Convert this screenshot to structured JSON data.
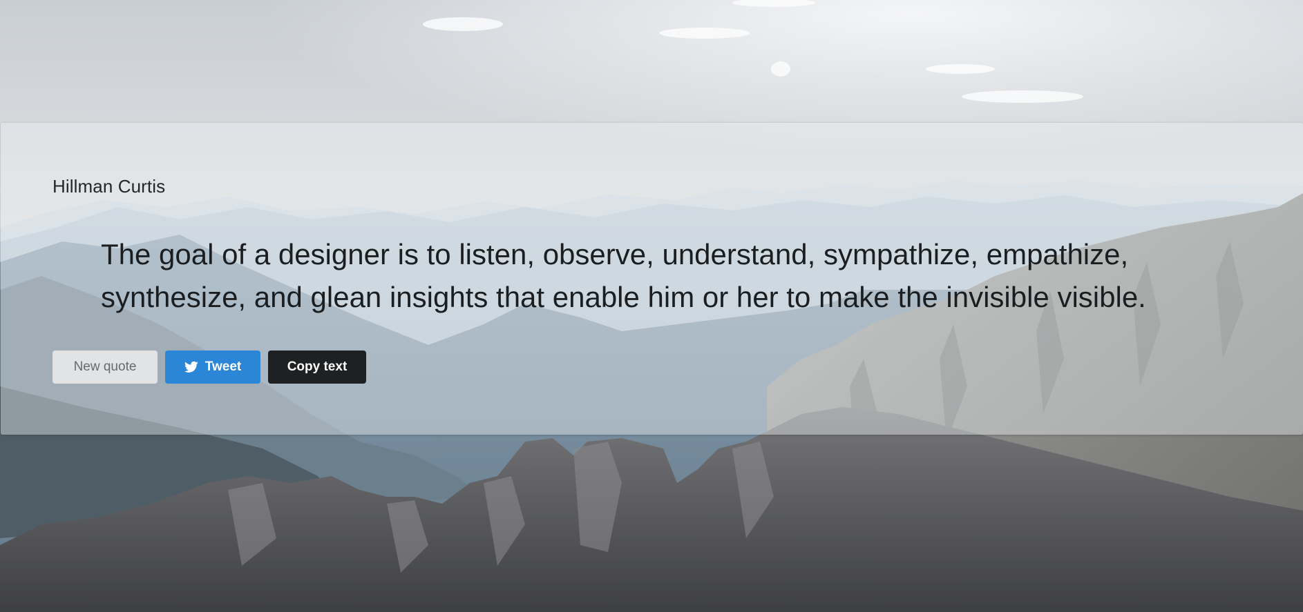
{
  "quote": {
    "author": "Hillman Curtis",
    "text": "The goal of a designer is to listen, observe, understand, sympathize, empathize, synthesize, and glean insights that enable him or her to make the invisible visible."
  },
  "actions": {
    "new_quote_label": "New quote",
    "tweet_label": "Tweet",
    "copy_label": "Copy text"
  },
  "icons": {
    "tweet": "twitter-bird-icon"
  },
  "colors": {
    "tweet_button": "#2b86d8",
    "copy_button": "#1e2022",
    "new_quote_button": "#e2e3e5",
    "text": "#1b1e20"
  }
}
